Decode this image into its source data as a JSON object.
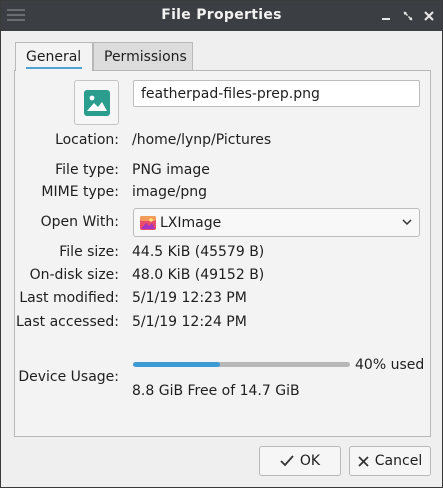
{
  "window": {
    "title": "File Properties"
  },
  "tabs": [
    {
      "label": "General",
      "active": true
    },
    {
      "label": "Permissions",
      "active": false
    }
  ],
  "file": {
    "name": "featherpad-files-prep.png",
    "icon": "image-icon"
  },
  "fields": {
    "location_label": "Location:",
    "location_value": "/home/lynp/Pictures",
    "filetype_label": "File type:",
    "filetype_value": "PNG image",
    "mimetype_label": "MIME type:",
    "mimetype_value": "image/png",
    "openwith_label": "Open With:",
    "openwith_value": "LXImage",
    "filesize_label": "File size:",
    "filesize_value": "44.5 KiB (45579 B)",
    "ondisk_label": "On-disk size:",
    "ondisk_value": "48.0 KiB (49152 B)",
    "modified_label": "Last modified:",
    "modified_value": "5/1/19 12:23 PM",
    "accessed_label": "Last accessed:",
    "accessed_value": "5/1/19 12:24 PM"
  },
  "device": {
    "label": "Device Usage:",
    "used_percent": 40,
    "used_text": "40% used",
    "free_text": "8.8 GiB Free of 14.7 GiB"
  },
  "buttons": {
    "ok": "OK",
    "cancel": "Cancel"
  },
  "colors": {
    "accent": "#3d9bd4",
    "file_icon_bg": "#2a9d8f",
    "titlebar": "#3b3e42"
  }
}
